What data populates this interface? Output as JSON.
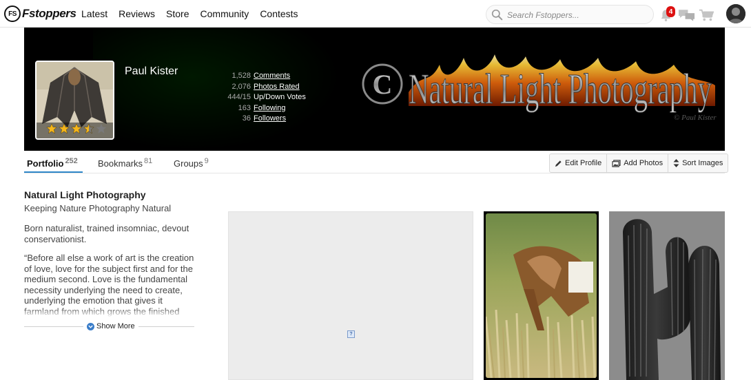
{
  "header": {
    "logo_badge": "FS",
    "logo_text": "Fstoppers",
    "nav": [
      "Latest",
      "Reviews",
      "Store",
      "Community",
      "Contests"
    ],
    "search_placeholder": "Search Fstoppers...",
    "notification_count": "4",
    "icons": [
      "search-icon",
      "bell-icon",
      "chat-icon",
      "cart-icon"
    ]
  },
  "profile": {
    "name": "Paul Kister",
    "rating_stars": 3.5,
    "rating_max": 5,
    "stats": [
      {
        "value": "1,528",
        "label": "Comments",
        "link": true
      },
      {
        "value": "2,076",
        "label": "Photos Rated",
        "link": true
      },
      {
        "value": "444/15",
        "label": "Up/Down Votes",
        "link": false
      },
      {
        "value": "163",
        "label": "Following",
        "link": true
      },
      {
        "value": "36",
        "label": "Followers",
        "link": true
      }
    ],
    "banner_text": "Natural Light Photography",
    "banner_mark": "C",
    "banner_credit": "© Paul Kister"
  },
  "tabs": [
    {
      "label": "Portfolio",
      "count": "252",
      "active": true
    },
    {
      "label": "Bookmarks",
      "count": "81",
      "active": false
    },
    {
      "label": "Groups",
      "count": "9",
      "active": false
    }
  ],
  "actions": {
    "edit": "Edit Profile",
    "add": "Add Photos",
    "sort": "Sort Images"
  },
  "sidebar": {
    "title": "Natural Light Photography",
    "subtitle": "Keeping Nature Photography Natural",
    "bio": "Born naturalist, trained insomniac, devout conservationist.",
    "quote": "“Before all else a work of art is the creation of love, love for the subject first and for the medium second. Love is the fundamental necessity underlying the need to create, underlying the emotion that gives it farmland from which grows the finished product that is presented to the world. Love is the",
    "show_more": "Show More"
  },
  "gallery": {
    "broken_glyph": "?"
  },
  "colors": {
    "accent": "#2d86c8",
    "badge": "#dd1111",
    "star": "#f5b61c"
  }
}
